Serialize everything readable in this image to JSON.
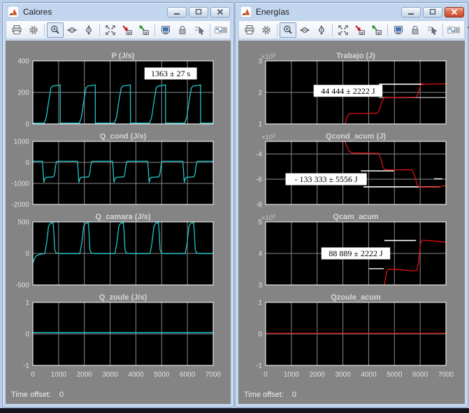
{
  "colors": {
    "desktop_bg": "#b9cde9",
    "taskbar": "#15151e",
    "canvas_bg": "#848484",
    "plot_bg": "#000000",
    "axis_box": "#ffffff",
    "grid": "#8a8a8a",
    "tick_text": "#e0e0e0",
    "title_text": "#d6d6d6",
    "trace_cyan": "#1ec8c8",
    "trace_red": "#e01010",
    "annotation_bg": "#ffffff",
    "annotation_text": "#000000"
  },
  "windows": [
    {
      "id": "calores",
      "title": "Calores",
      "active": false,
      "pressed_tool": "zoom",
      "toolbar": [
        "print",
        "parameters",
        "|",
        "zoom",
        "zoom-x",
        "zoom-y",
        "|",
        "autoscale",
        "save-axes",
        "restore-axes",
        "|",
        "floating-scope",
        "lock-axes",
        "signal-selection",
        "|",
        "signal-viewer",
        "dock"
      ],
      "time_offset_label": "Time offset:",
      "time_offset_value": "0"
    },
    {
      "id": "energias",
      "title": "Energías",
      "active": true,
      "pressed_tool": "zoom",
      "toolbar": [
        "print",
        "parameters",
        "|",
        "zoom",
        "zoom-x",
        "zoom-y",
        "|",
        "autoscale",
        "save-axes",
        "restore-axes",
        "|",
        "floating-scope",
        "lock-axes",
        "signal-selection",
        "|",
        "signal-viewer",
        "dock"
      ],
      "time_offset_label": "Time offset:",
      "time_offset_value": "0"
    }
  ],
  "chart_data": [
    {
      "id": "p",
      "type": "line",
      "title": "P (J/s)",
      "xlim": [
        0,
        7000
      ],
      "ylim": [
        0,
        400
      ],
      "xticks": [
        0,
        1000,
        2000,
        3000,
        4000,
        5000,
        6000,
        7000
      ],
      "yticks": [
        {
          "v": 0,
          "label": "0"
        },
        {
          "v": 200,
          "label": "200"
        },
        {
          "v": 400,
          "label": "400"
        }
      ],
      "show_x_labels": false,
      "exponent": null,
      "line_color": "#1ec8c8",
      "points": [
        [
          0,
          5
        ],
        [
          440,
          5
        ],
        [
          520,
          40
        ],
        [
          620,
          150
        ],
        [
          700,
          228
        ],
        [
          760,
          240
        ],
        [
          1010,
          246
        ],
        [
          1060,
          248
        ],
        [
          1063,
          5
        ],
        [
          1803,
          5
        ],
        [
          1883,
          40
        ],
        [
          1983,
          150
        ],
        [
          2063,
          228
        ],
        [
          2123,
          240
        ],
        [
          2373,
          246
        ],
        [
          2423,
          248
        ],
        [
          2426,
          5
        ],
        [
          3166,
          5
        ],
        [
          3246,
          40
        ],
        [
          3346,
          150
        ],
        [
          3426,
          228
        ],
        [
          3486,
          240
        ],
        [
          3736,
          246
        ],
        [
          3786,
          248
        ],
        [
          3789,
          5
        ],
        [
          4529,
          5
        ],
        [
          4609,
          40
        ],
        [
          4709,
          150
        ],
        [
          4789,
          228
        ],
        [
          4849,
          240
        ],
        [
          5099,
          246
        ],
        [
          5149,
          248
        ],
        [
          5152,
          5
        ],
        [
          5892,
          5
        ],
        [
          5972,
          40
        ],
        [
          6072,
          150
        ],
        [
          6152,
          228
        ],
        [
          6212,
          240
        ],
        [
          6462,
          246
        ],
        [
          6512,
          248
        ],
        [
          6515,
          5
        ],
        [
          7000,
          5
        ]
      ],
      "measure_lines": [],
      "annotation": {
        "x": 5350,
        "y": 320,
        "text": "1363 ± 27 s"
      }
    },
    {
      "id": "q_cond",
      "type": "line",
      "title": "Q_cond (J/s)",
      "xlim": [
        0,
        7000
      ],
      "ylim": [
        -2000,
        1000
      ],
      "xticks": [
        0,
        1000,
        2000,
        3000,
        4000,
        5000,
        6000,
        7000
      ],
      "yticks": [
        {
          "v": -2000,
          "label": "-2000"
        },
        {
          "v": -1000,
          "label": "-1000"
        },
        {
          "v": 0,
          "label": "0"
        },
        {
          "v": 1000,
          "label": "1000"
        }
      ],
      "show_x_labels": false,
      "exponent": null,
      "line_color": "#1ec8c8",
      "points": [
        [
          0,
          55
        ],
        [
          370,
          55
        ],
        [
          395,
          -400
        ],
        [
          425,
          -950
        ],
        [
          465,
          -770
        ],
        [
          510,
          -715
        ],
        [
          800,
          -690
        ],
        [
          845,
          -540
        ],
        [
          885,
          -150
        ],
        [
          920,
          35
        ],
        [
          955,
          55
        ],
        [
          1733,
          55
        ],
        [
          1758,
          -400
        ],
        [
          1788,
          -950
        ],
        [
          1828,
          -770
        ],
        [
          1873,
          -715
        ],
        [
          2163,
          -690
        ],
        [
          2208,
          -540
        ],
        [
          2248,
          -150
        ],
        [
          2283,
          35
        ],
        [
          2318,
          55
        ],
        [
          3096,
          55
        ],
        [
          3121,
          -400
        ],
        [
          3151,
          -950
        ],
        [
          3191,
          -770
        ],
        [
          3236,
          -715
        ],
        [
          3526,
          -690
        ],
        [
          3571,
          -540
        ],
        [
          3611,
          -150
        ],
        [
          3646,
          35
        ],
        [
          3681,
          55
        ],
        [
          4459,
          55
        ],
        [
          4484,
          -400
        ],
        [
          4514,
          -950
        ],
        [
          4554,
          -770
        ],
        [
          4599,
          -715
        ],
        [
          4889,
          -690
        ],
        [
          4934,
          -540
        ],
        [
          4974,
          -150
        ],
        [
          5009,
          35
        ],
        [
          5044,
          55
        ],
        [
          5822,
          55
        ],
        [
          5847,
          -400
        ],
        [
          5877,
          -950
        ],
        [
          5917,
          -770
        ],
        [
          5962,
          -715
        ],
        [
          6252,
          -690
        ],
        [
          6297,
          -540
        ],
        [
          6337,
          -150
        ],
        [
          6372,
          35
        ],
        [
          6407,
          55
        ],
        [
          7000,
          55
        ]
      ],
      "measure_lines": [],
      "annotation": null
    },
    {
      "id": "q_camara",
      "type": "line",
      "title": "Q_camara (J/s)",
      "xlim": [
        0,
        7000
      ],
      "ylim": [
        -500,
        500
      ],
      "xticks": [
        0,
        1000,
        2000,
        3000,
        4000,
        5000,
        6000,
        7000
      ],
      "yticks": [
        {
          "v": -500,
          "label": "-500"
        },
        {
          "v": 0,
          "label": "0"
        },
        {
          "v": 500,
          "label": "500"
        }
      ],
      "show_x_labels": false,
      "exponent": null,
      "line_color": "#1ec8c8",
      "points": [
        [
          0,
          -155
        ],
        [
          60,
          -85
        ],
        [
          150,
          -32
        ],
        [
          300,
          -12
        ],
        [
          440,
          -4
        ],
        [
          460,
          -3
        ],
        [
          530,
          150
        ],
        [
          610,
          430
        ],
        [
          670,
          475
        ],
        [
          790,
          485
        ],
        [
          820,
          300
        ],
        [
          850,
          60
        ],
        [
          900,
          8
        ],
        [
          1020,
          -3
        ],
        [
          1823,
          -3
        ],
        [
          1893,
          150
        ],
        [
          1973,
          430
        ],
        [
          2033,
          475
        ],
        [
          2153,
          485
        ],
        [
          2183,
          300
        ],
        [
          2213,
          60
        ],
        [
          2263,
          8
        ],
        [
          2383,
          -3
        ],
        [
          3186,
          -3
        ],
        [
          3256,
          150
        ],
        [
          3336,
          430
        ],
        [
          3396,
          475
        ],
        [
          3516,
          485
        ],
        [
          3546,
          300
        ],
        [
          3576,
          60
        ],
        [
          3626,
          8
        ],
        [
          3746,
          -3
        ],
        [
          4549,
          -3
        ],
        [
          4619,
          150
        ],
        [
          4699,
          430
        ],
        [
          4759,
          475
        ],
        [
          4879,
          485
        ],
        [
          4909,
          300
        ],
        [
          4939,
          60
        ],
        [
          4989,
          8
        ],
        [
          5109,
          -3
        ],
        [
          5912,
          -3
        ],
        [
          5982,
          150
        ],
        [
          6062,
          430
        ],
        [
          6122,
          475
        ],
        [
          6242,
          485
        ],
        [
          6272,
          300
        ],
        [
          6302,
          60
        ],
        [
          6352,
          8
        ],
        [
          6472,
          -3
        ],
        [
          7000,
          -3
        ]
      ],
      "measure_lines": [],
      "annotation": null
    },
    {
      "id": "q_zoule",
      "type": "line",
      "title": "Q_zoule (J/s)",
      "xlim": [
        0,
        7000
      ],
      "ylim": [
        -1,
        1
      ],
      "xticks": [
        0,
        1000,
        2000,
        3000,
        4000,
        5000,
        6000,
        7000
      ],
      "yticks": [
        {
          "v": -1,
          "label": "-1"
        },
        {
          "v": 0,
          "label": "0"
        },
        {
          "v": 1,
          "label": "1"
        }
      ],
      "show_x_labels": true,
      "exponent": null,
      "line_color": "#1ec8c8",
      "points": [
        [
          0,
          0.04
        ],
        [
          7000,
          0.04
        ]
      ],
      "measure_lines": [],
      "annotation": null
    },
    {
      "id": "trabajo",
      "type": "line",
      "title": "Trabajo (J)",
      "xlim": [
        0,
        7000
      ],
      "ylim": [
        100000,
        300000
      ],
      "xticks": [
        0,
        1000,
        2000,
        3000,
        4000,
        5000,
        6000,
        7000
      ],
      "yticks": [
        {
          "v": 100000,
          "label": "1"
        },
        {
          "v": 200000,
          "label": "2"
        },
        {
          "v": 300000,
          "label": "3"
        }
      ],
      "show_x_labels": false,
      "exponent": "×10^5",
      "line_color": "#e01010",
      "points": [
        [
          3040,
          90000
        ],
        [
          3110,
          108000
        ],
        [
          3190,
          127000
        ],
        [
          3265,
          132500
        ],
        [
          3700,
          133200
        ],
        [
          4330,
          133800
        ],
        [
          4420,
          146000
        ],
        [
          4520,
          172000
        ],
        [
          4600,
          183000
        ],
        [
          5100,
          184000
        ],
        [
          5840,
          184600
        ],
        [
          5920,
          197000
        ],
        [
          6010,
          222000
        ],
        [
          6075,
          226000
        ],
        [
          6600,
          226800
        ],
        [
          7000,
          227200
        ]
      ],
      "measure_lines": [
        {
          "y": 226000,
          "x1": 4400,
          "x2": 6150,
          "color": "#ffffff",
          "width": 1.6
        },
        {
          "y": 183600,
          "x1": 4400,
          "x2": 7000,
          "color": "#a8a8a8",
          "width": 1.4
        }
      ],
      "annotation": {
        "x": 3200,
        "y": 205000,
        "text": "44 444 ± 2222 J"
      }
    },
    {
      "id": "qcond_acum",
      "type": "line",
      "title": "Qcond_acum (J)",
      "xlim": [
        0,
        7000
      ],
      "ylim": [
        -800000,
        -300000
      ],
      "xticks": [
        0,
        1000,
        2000,
        3000,
        4000,
        5000,
        6000,
        7000
      ],
      "yticks": [
        {
          "v": -800000,
          "label": "-8"
        },
        {
          "v": -600000,
          "label": "-6"
        },
        {
          "v": -400000,
          "label": "-4"
        }
      ],
      "show_x_labels": false,
      "exponent": "×10^5",
      "line_color": "#e01010",
      "points": [
        [
          3060,
          -285000
        ],
        [
          3140,
          -332000
        ],
        [
          3240,
          -378000
        ],
        [
          3370,
          -391500
        ],
        [
          3900,
          -393500
        ],
        [
          4390,
          -395000
        ],
        [
          4470,
          -440000
        ],
        [
          4560,
          -506000
        ],
        [
          4625,
          -524000
        ],
        [
          4900,
          -527000
        ],
        [
          5300,
          -526000
        ],
        [
          5680,
          -525000
        ],
        [
          5775,
          -566000
        ],
        [
          5885,
          -645000
        ],
        [
          5955,
          -660000
        ],
        [
          6400,
          -662500
        ],
        [
          6770,
          -660000
        ],
        [
          6960,
          -652000
        ],
        [
          7000,
          -650500
        ]
      ],
      "measure_lines": [
        {
          "y": -534000,
          "x1": 3700,
          "x2": 4975,
          "color": "#ffffff",
          "width": 1.6
        },
        {
          "y": -661000,
          "x1": 3800,
          "x2": 6770,
          "color": "#ffffff",
          "width": 1.6
        },
        {
          "y": -597000,
          "x1": 6540,
          "x2": 6860,
          "color": "#ffffff",
          "width": 1.4
        }
      ],
      "annotation": {
        "x": 2350,
        "y": -600000,
        "text": "- 133 333 ± 5556 J"
      }
    },
    {
      "id": "qcam_acum",
      "type": "line",
      "title": "Qcam_acum",
      "xlim": [
        0,
        7000
      ],
      "ylim": [
        300000,
        500000
      ],
      "xticks": [
        0,
        1000,
        2000,
        3000,
        4000,
        5000,
        6000,
        7000
      ],
      "yticks": [
        {
          "v": 300000,
          "label": "3"
        },
        {
          "v": 400000,
          "label": "4"
        },
        {
          "v": 500000,
          "label": "5"
        }
      ],
      "show_x_labels": false,
      "exponent": "×10^5",
      "line_color": "#e01010",
      "points": [
        [
          4590,
          292000
        ],
        [
          4655,
          322000
        ],
        [
          4715,
          346000
        ],
        [
          4755,
          350500
        ],
        [
          5200,
          348500
        ],
        [
          5700,
          344500
        ],
        [
          5865,
          345500
        ],
        [
          5935,
          372000
        ],
        [
          6015,
          430000
        ],
        [
          6075,
          442000
        ],
        [
          6500,
          439500
        ],
        [
          7000,
          435500
        ]
      ],
      "measure_lines": [
        {
          "y": 441000,
          "x1": 4610,
          "x2": 5840,
          "color": "#ffffff",
          "width": 1.6
        },
        {
          "y": 351500,
          "x1": 4010,
          "x2": 4590,
          "color": "#ffffff",
          "width": 1.4
        }
      ],
      "annotation": {
        "x": 3500,
        "y": 400000,
        "text": "88 889 ± 2222 J"
      }
    },
    {
      "id": "qzoule_acum",
      "type": "line",
      "title": "Qzoule_acum",
      "xlim": [
        0,
        7000
      ],
      "ylim": [
        -1,
        1
      ],
      "xticks": [
        0,
        1000,
        2000,
        3000,
        4000,
        5000,
        6000,
        7000
      ],
      "yticks": [
        {
          "v": -1,
          "label": "-1"
        },
        {
          "v": 0,
          "label": "0"
        },
        {
          "v": 1,
          "label": "1"
        }
      ],
      "show_x_labels": true,
      "exponent": null,
      "line_color": "#e01010",
      "points": [
        [
          0,
          0.02
        ],
        [
          7000,
          0.02
        ]
      ],
      "measure_lines": [],
      "annotation": null
    }
  ]
}
